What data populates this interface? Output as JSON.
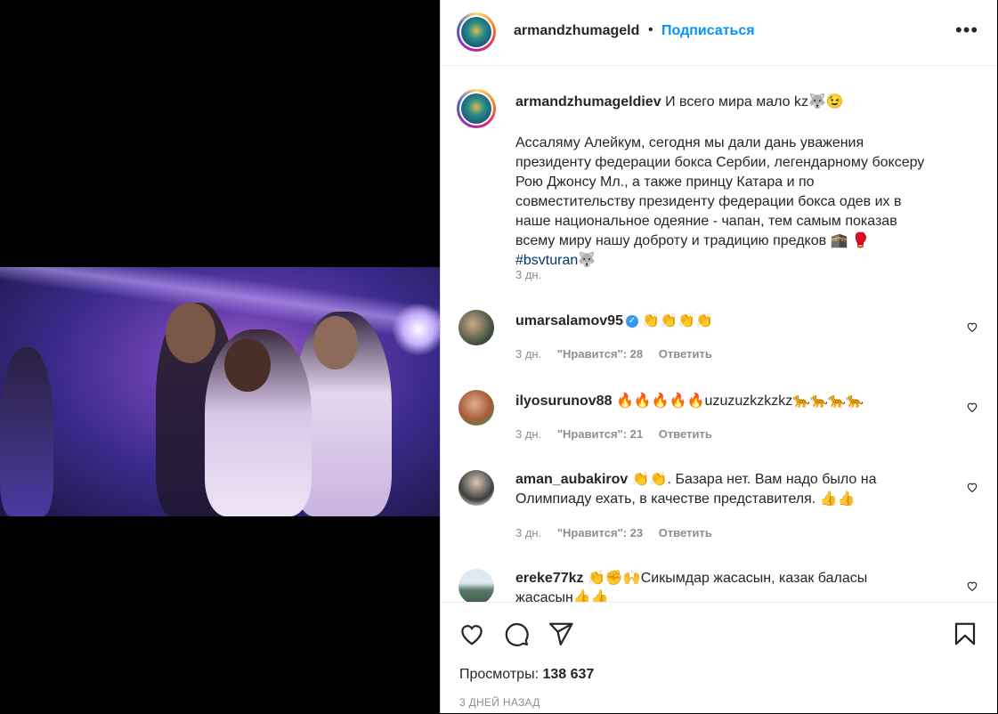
{
  "post": {
    "username": "armandzhumageldiev",
    "username_short": "armandzhumageld",
    "follow_label": "Подписаться",
    "more_label": "•••",
    "caption_title": "И всего мира мало kz🐺😉",
    "caption_body": "Ассаляму Алейкум, сегодня мы дали дань уважения президенту федерации бокса Сербии, легендарному боксеру Рою Джонсу Мл., а также принцу Катара и по совместительству президенту федерации бокса одев их в наше национальное одеяние - чапан, тем самым показав всему миру нашу доброту и традицию предков 🕋 🥊",
    "caption_tag": "#bsvturan",
    "caption_tag_suffix": "🐺",
    "caption_time": "3 дн.",
    "views_label": "Просмотры:",
    "views_count": "138 637",
    "posted_ago": "3 ДНЕЙ НАЗАД"
  },
  "comments": [
    {
      "user": "umarsalamov95",
      "verified": true,
      "text": "👏👏👏👏",
      "time": "3 дн.",
      "likes": "\"Нравится\": 28",
      "reply": "Ответить",
      "avatar_color": "#3a4a3a"
    },
    {
      "user": "ilyosurunov88",
      "verified": false,
      "text": "🔥🔥🔥🔥🔥uzuzuzkzkzkz🐆🐆🐆🐆",
      "time": "3 дн.",
      "likes": "\"Нравится\": 21",
      "reply": "Ответить",
      "avatar_color": "#a85a3a"
    },
    {
      "user": "aman_aubakirov",
      "verified": false,
      "text": "👏👏. Базара нет. Вам надо было на Олимпиаду ехать, в качестве представителя. 👍👍",
      "time": "3 дн.",
      "likes": "\"Нравится\": 23",
      "reply": "Ответить",
      "avatar_color": "#3c3c3c"
    },
    {
      "user": "ereke77kz",
      "verified": false,
      "text": "👏✊🙌Сикымдар жасасын, казак баласы жасасын👍👍",
      "time": "",
      "likes": "",
      "reply": "",
      "avatar_color": "#5a7a6a"
    }
  ],
  "icons": [
    "more-icon",
    "heart-icon",
    "comment-icon",
    "share-icon",
    "bookmark-icon",
    "verified-badge-icon"
  ],
  "colors": {
    "link": "#0095f6",
    "hashtag": "#00376b",
    "muted": "#8e8e8e",
    "text": "#262626",
    "verified": "#3897f0"
  }
}
